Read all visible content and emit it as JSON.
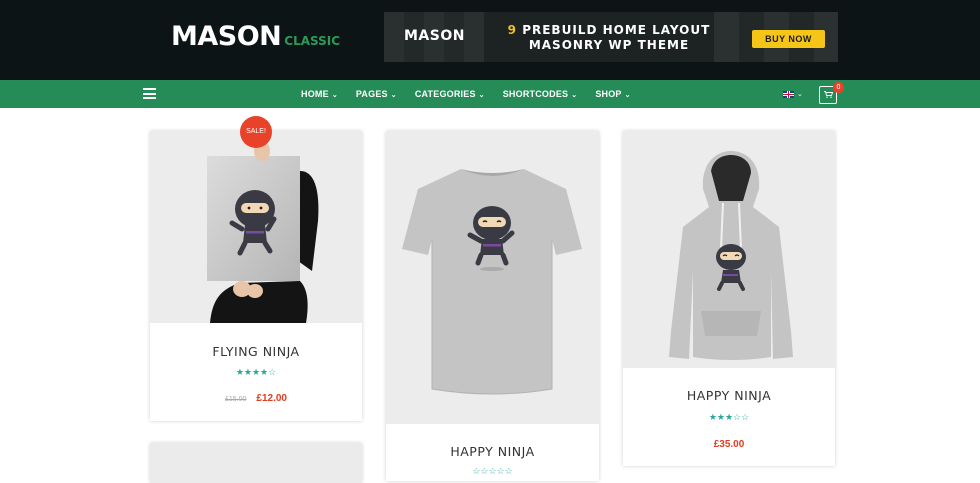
{
  "header": {
    "logo_main": "MASON",
    "logo_sub": "CLASSIC",
    "banner": {
      "brand": "MASON",
      "line1_num": "9",
      "line1_text": "PREBUILD HOME LAYOUT",
      "line2": "MASONRY WP THEME",
      "cta": "BUY NOW"
    }
  },
  "nav": {
    "items": [
      {
        "label": "HOME"
      },
      {
        "label": "PAGES"
      },
      {
        "label": "CATEGORIES"
      },
      {
        "label": "SHORTCODES"
      },
      {
        "label": "SHOP"
      }
    ],
    "cart_count": "0",
    "icons": {
      "menu": "hamburger-icon",
      "language": "uk-flag-icon",
      "cart": "shopping-cart-icon"
    }
  },
  "products": [
    {
      "name": "FLYING NINJA",
      "badge": "SALE!",
      "old_price": "£15.00",
      "price": "£12.00",
      "rating": 4
    },
    {
      "name": "HAPPY NINJA",
      "rating": 0
    },
    {
      "name": "HAPPY NINJA",
      "price": "£35.00",
      "rating": 3
    }
  ],
  "colors": {
    "header_bg": "#0d1415",
    "nav_bg": "#268c57",
    "accent_green": "#2d9a5a",
    "sale_red": "#e8432a",
    "price_red": "#e33b1f",
    "star_teal": "#2aa89a"
  }
}
